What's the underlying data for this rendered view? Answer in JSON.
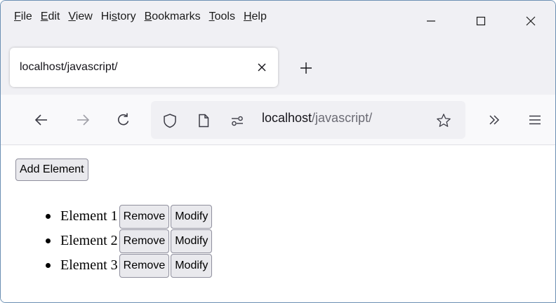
{
  "menubar": {
    "items": [
      {
        "pre": "",
        "u": "F",
        "post": "ile"
      },
      {
        "pre": "",
        "u": "E",
        "post": "dit"
      },
      {
        "pre": "",
        "u": "V",
        "post": "iew"
      },
      {
        "pre": "Hi",
        "u": "s",
        "post": "tory"
      },
      {
        "pre": "",
        "u": "B",
        "post": "ookmarks"
      },
      {
        "pre": "",
        "u": "T",
        "post": "ools"
      },
      {
        "pre": "",
        "u": "H",
        "post": "elp"
      }
    ]
  },
  "tab": {
    "title": "localhost/javascript/"
  },
  "url": {
    "host": "localhost",
    "path": "/javascript/"
  },
  "page": {
    "add_label": "Add Element",
    "items": [
      {
        "label": "Element 1",
        "remove": "Remove",
        "modify": "Modify"
      },
      {
        "label": "Element 2",
        "remove": "Remove",
        "modify": "Modify"
      },
      {
        "label": "Element 3",
        "remove": "Remove",
        "modify": "Modify"
      }
    ]
  },
  "colors": {
    "chrome_bg": "#f0f0f4",
    "toolbar_bg": "#f9f9fb",
    "button_bg": "#e9e9ed",
    "window_border": "#6b8fb3"
  },
  "icons": [
    "minimize-icon",
    "maximize-icon",
    "close-icon",
    "tab-close-icon",
    "plus-icon",
    "back-arrow-icon",
    "forward-arrow-icon",
    "reload-icon",
    "shield-icon",
    "page-icon",
    "permissions-icon",
    "star-icon",
    "overflow-chevrons-icon",
    "hamburger-menu-icon"
  ]
}
